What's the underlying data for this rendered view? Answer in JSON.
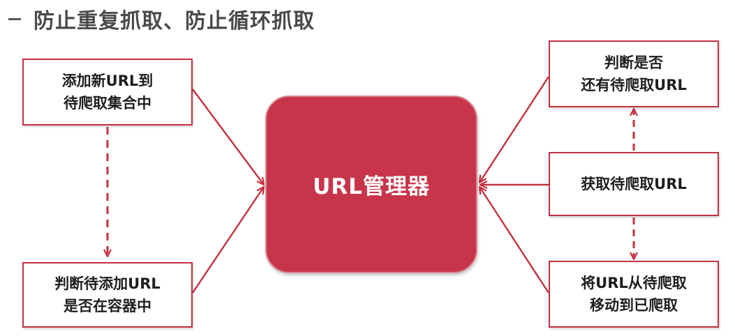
{
  "title": "防止重复抓取、防止循环抓取",
  "center_label": "URL管理器",
  "boxes": {
    "add_url": {
      "line1": "添加新URL到",
      "line2": "待爬取集合中"
    },
    "check_in_container": {
      "line1": "判断待添加URL",
      "line2": "是否在容器中"
    },
    "has_pending": {
      "line1": "判断是否",
      "line2": "还有待爬取URL"
    },
    "get_pending": {
      "line1": "获取待爬取URL"
    },
    "move_to_crawled": {
      "line1": "将URL从待爬取",
      "line2": "移动到已爬取"
    }
  },
  "colors": {
    "accent": "#c5303f",
    "center_fill": "#c8354a",
    "title_text": "#4a4a4a"
  }
}
